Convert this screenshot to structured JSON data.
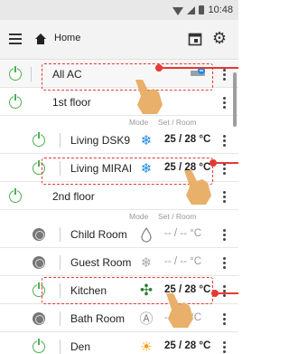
{
  "status_bar": {
    "time": "10:48"
  },
  "app_bar": {
    "title": "Home"
  },
  "column_headers": {
    "mode": "Mode",
    "set_room": "Set / Room"
  },
  "rows": [
    {
      "label": "All AC",
      "state": "on",
      "kind": "all"
    },
    {
      "label": "1st floor",
      "state": "on",
      "kind": "floor"
    },
    {
      "label": "Living DSK9",
      "state": "on",
      "kind": "room",
      "mode_icon": "snowflake-icon",
      "temp": "25 / 28 °C"
    },
    {
      "label": "Living MIRAI",
      "state": "on",
      "kind": "room",
      "mode_icon": "snowflake-icon",
      "temp": "25 / 28 °C"
    },
    {
      "label": "2nd floor",
      "state": "on",
      "kind": "floor"
    },
    {
      "label": "Child Room",
      "state": "off",
      "kind": "room",
      "mode_icon": "dry-icon",
      "temp": "-- / --  °C"
    },
    {
      "label": "Guest Room",
      "state": "off",
      "kind": "room",
      "mode_icon": "snowflake-icon",
      "temp": "-- / --  °C"
    },
    {
      "label": "Kitchen",
      "state": "on",
      "kind": "room",
      "mode_icon": "fan-icon",
      "temp": "25 / 28  °C"
    },
    {
      "label": "Bath Room",
      "state": "off",
      "kind": "room",
      "mode_icon": "auto-icon",
      "temp": "-- / --  °C"
    },
    {
      "label": "Den",
      "state": "on",
      "kind": "room",
      "mode_icon": "sun-icon",
      "temp": "25 / 28 °C"
    }
  ],
  "mode_icon_glyphs": {
    "snowflake": "❄",
    "dry": "Δ",
    "fan": "✣",
    "auto": "Ⓐ",
    "sun": "☀"
  },
  "colors": {
    "power_on": "#4caf50",
    "cool": "#1e88e5",
    "fan": "#2e7d32",
    "heat": "#ff9800",
    "annotation": "#e53935"
  }
}
